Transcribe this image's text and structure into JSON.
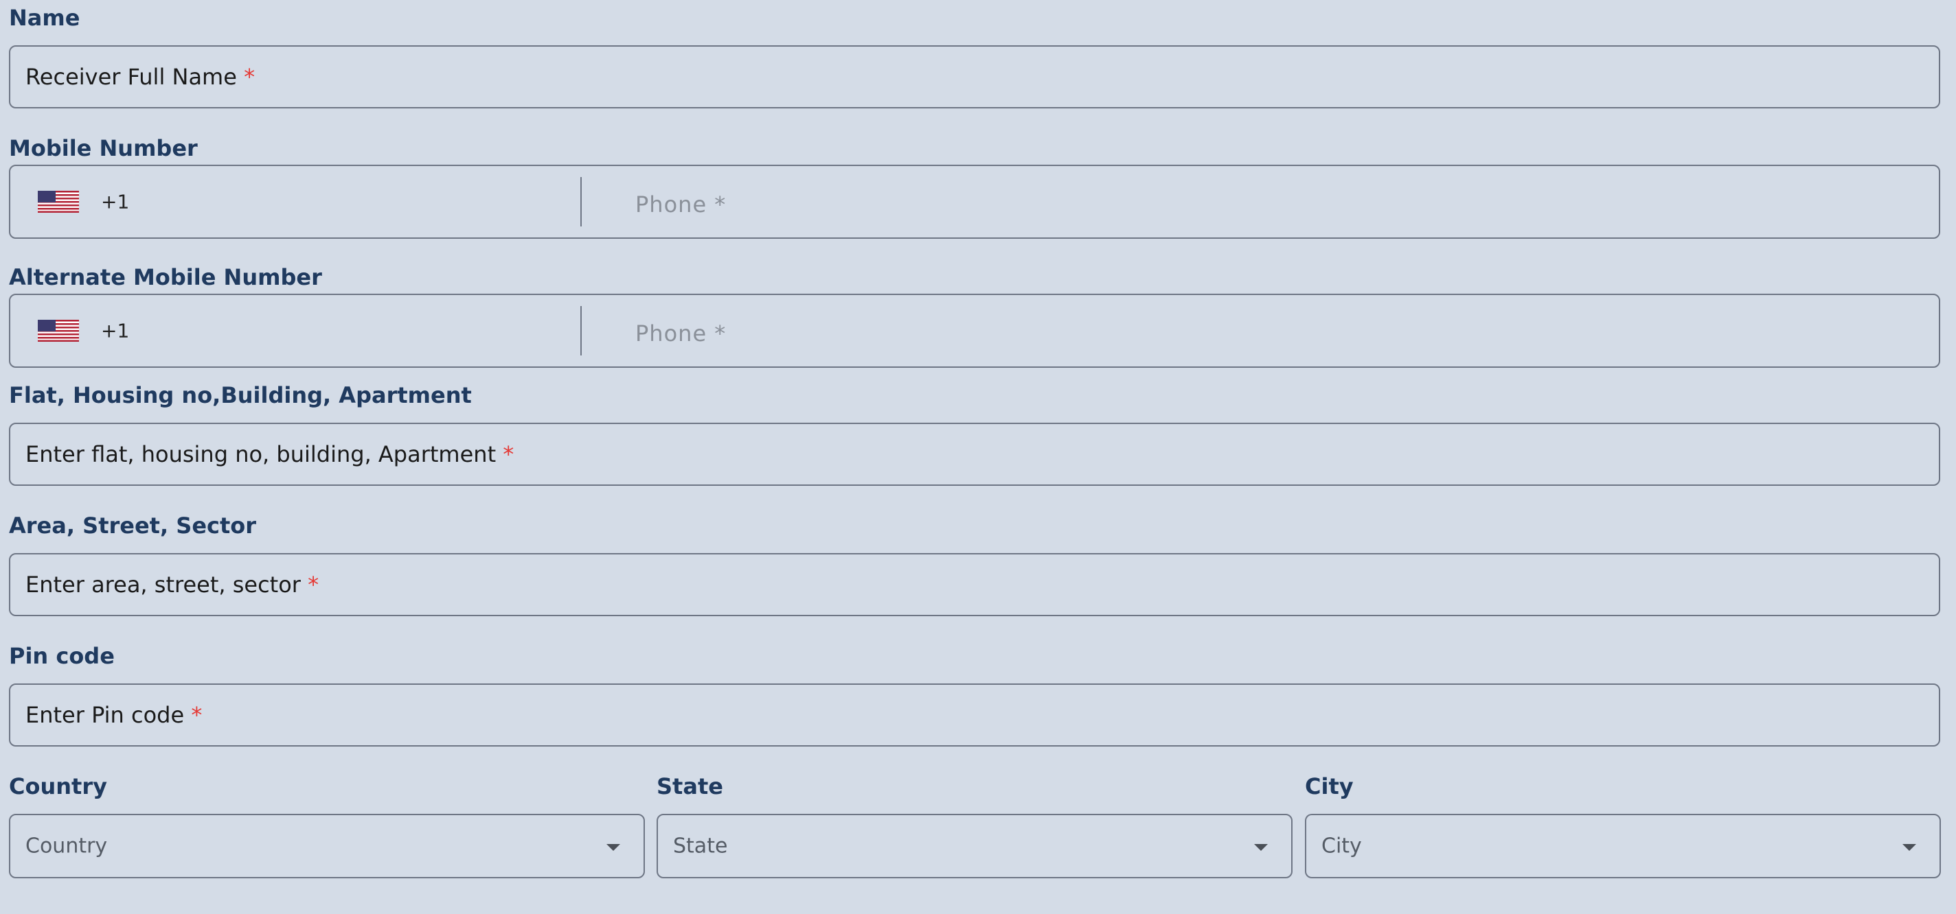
{
  "name": {
    "label": "Name",
    "placeholder": "Receiver Full Name",
    "required_mark": "*"
  },
  "mobile": {
    "label": "Mobile Number",
    "country_code": "+1",
    "flag": "us-flag-icon",
    "placeholder": "Phone *"
  },
  "alt_mobile": {
    "label": "Alternate Mobile Number",
    "country_code": "+1",
    "flag": "us-flag-icon",
    "placeholder": "Phone *"
  },
  "flat": {
    "label": "Flat, Housing no,Building, Apartment",
    "placeholder": "Enter flat, housing no, building, Apartment",
    "required_mark": "*"
  },
  "area": {
    "label": "Area, Street, Sector",
    "placeholder": "Enter area, street, sector",
    "required_mark": "*"
  },
  "pin": {
    "label": "Pin code",
    "placeholder": "Enter Pin code",
    "required_mark": "*"
  },
  "country": {
    "label": "Country",
    "placeholder": "Country"
  },
  "state": {
    "label": "State",
    "placeholder": "State"
  },
  "city": {
    "label": "City",
    "placeholder": "City"
  },
  "colors": {
    "background": "#d4dce7",
    "label": "#1f3a5f",
    "required": "#e53935",
    "border": "#6e7685"
  }
}
